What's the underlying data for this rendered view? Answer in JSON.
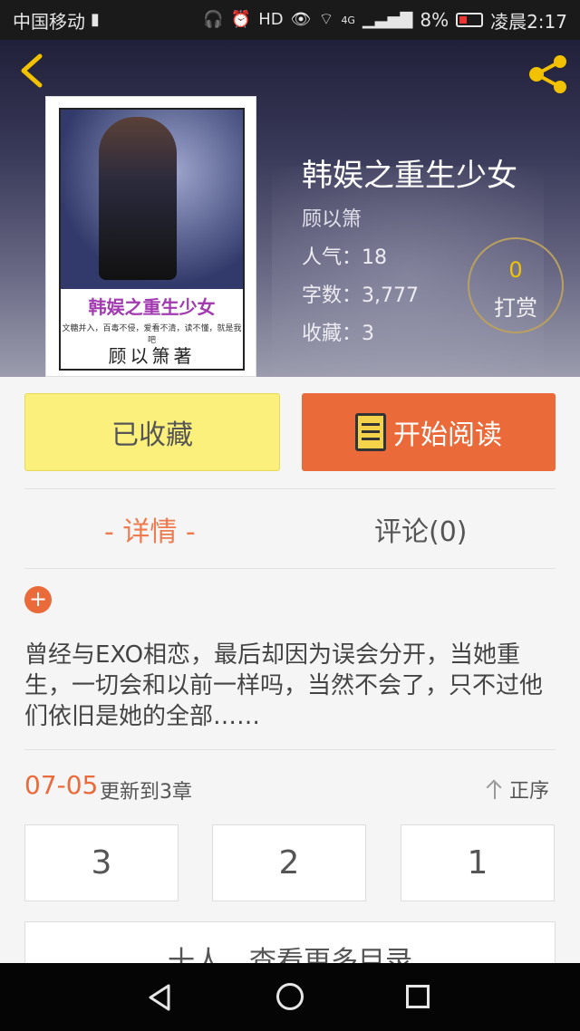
{
  "status_bar": {
    "carrier": "中国移动",
    "network": "4G",
    "battery": "8%",
    "time": "凌晨2:17",
    "icons": [
      "sim-alert-icon",
      "headphones-icon",
      "alarm-icon",
      "hd-icon",
      "eye-icon",
      "wifi-icon",
      "signal-icon",
      "battery-icon"
    ]
  },
  "header": {
    "back_icon": "chevron-left-icon",
    "share_icon": "share-icon",
    "accent_color": "#f2c200"
  },
  "cover": {
    "title": "韩娱之重生少女",
    "tagline": "文糖并入，百毒不侵，爱看不清，读不懂，就是我吧",
    "author": "顾以箫著"
  },
  "book": {
    "title": "韩娱之重生少女",
    "author": "顾以箫",
    "popularity": "人气：18",
    "word_count": "字数：3,777",
    "favorites": "收藏：3"
  },
  "tip": {
    "count": "0",
    "label": "打赏"
  },
  "actions": {
    "collected_label": "已收藏",
    "read_label": "开始阅读",
    "collected_color": "#fbf07b",
    "read_color": "#ea6a3a"
  },
  "tabs": [
    {
      "label": "- 详情 -",
      "active": true
    },
    {
      "label": "评论(0)",
      "active": false
    }
  ],
  "synopsis": "曾经与EXO相恋，最后却因为误会分开，当她重生，一切会和以前一样吗，当然不会了，只不过他们依旧是她的全部……",
  "update": {
    "date": "07-05",
    "text": "更新到3章",
    "sort_label": "正序"
  },
  "chapters": [
    "3",
    "2",
    "1"
  ],
  "more_catalog": "十人，查看更多目录"
}
